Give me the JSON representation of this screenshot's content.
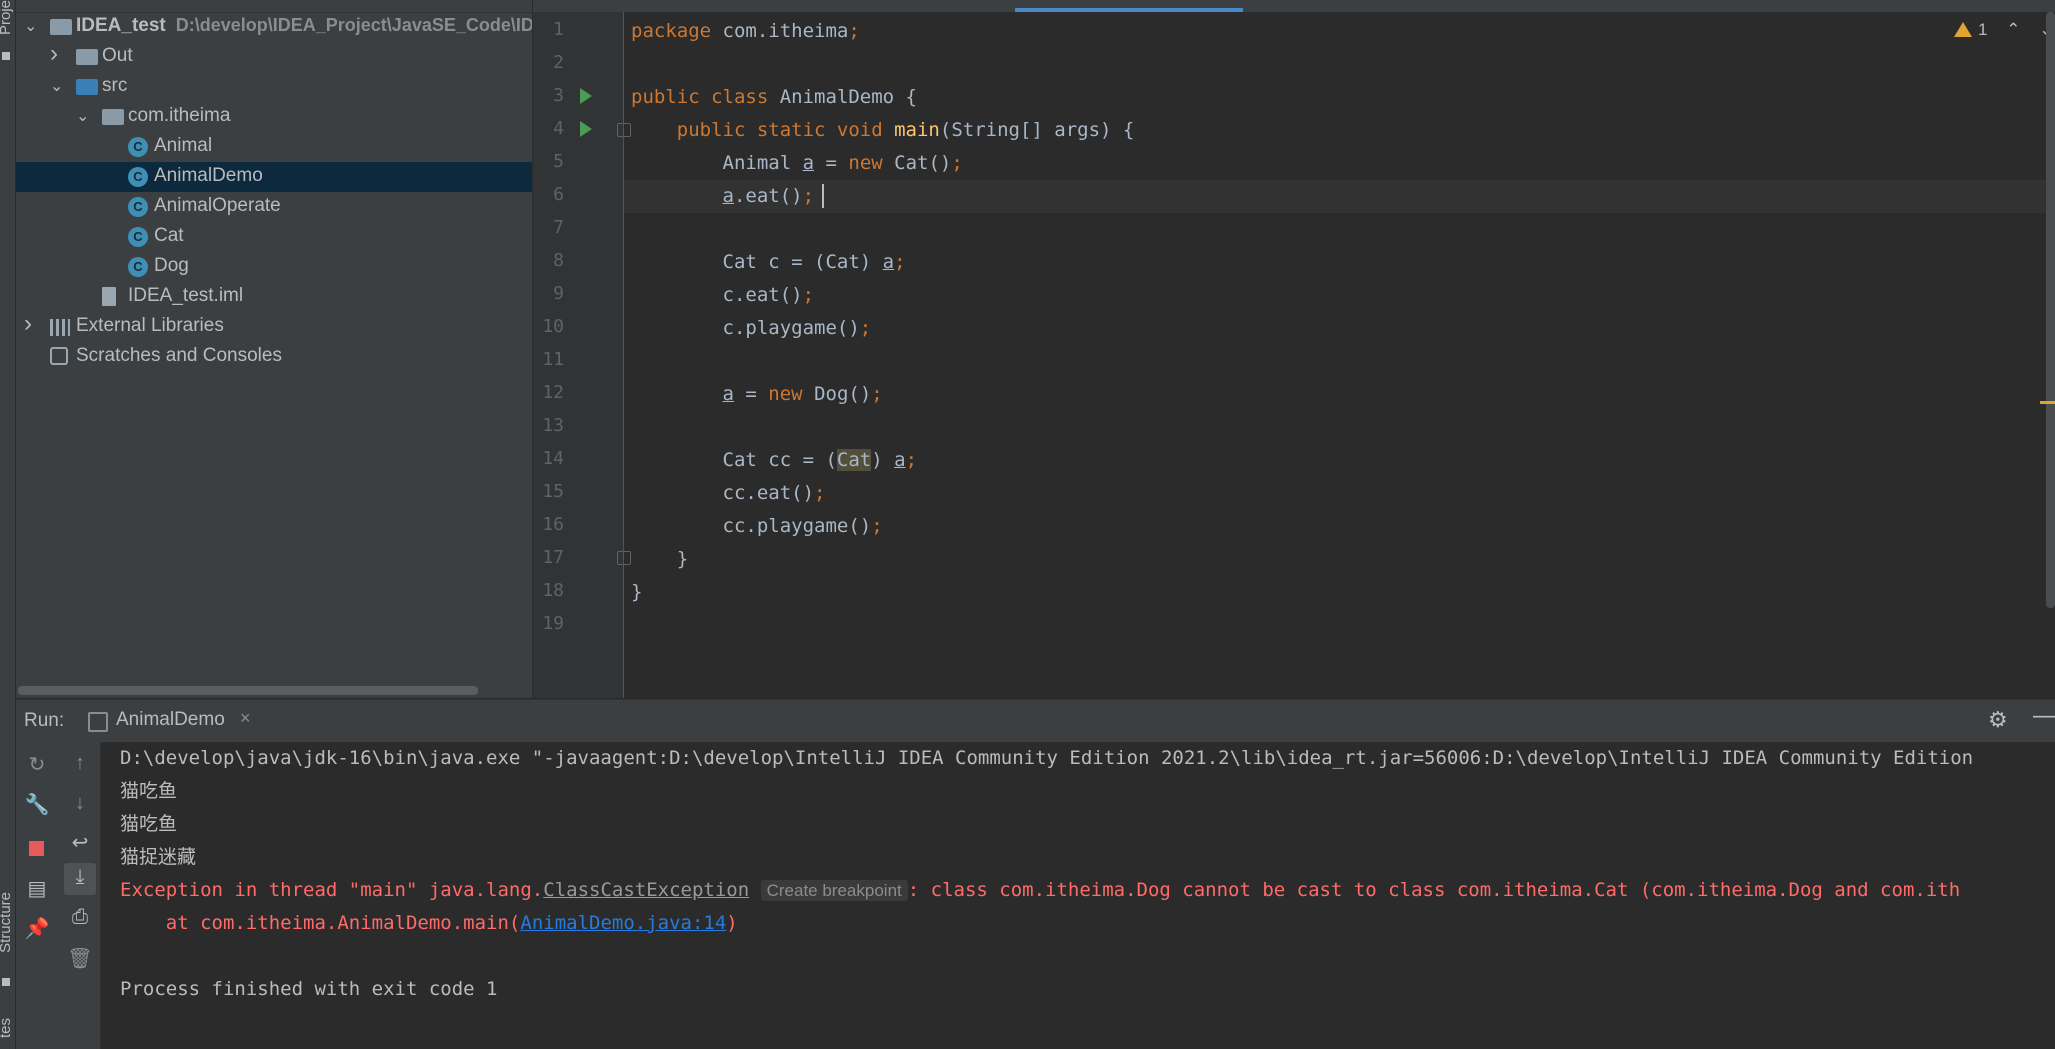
{
  "left_strip": {
    "top_label": "Proje",
    "structure_label": "Structure",
    "bottom_label": "tes"
  },
  "project_tree": [
    {
      "label": "IDEA_test",
      "hint": "D:\\develop\\IDEA_Project\\JavaSE_Code\\IDE",
      "icon": "module-folder-icon",
      "expanded": true,
      "depth": 0
    },
    {
      "label": "Out",
      "icon": "folder-icon",
      "expanded": false,
      "depth": 1
    },
    {
      "label": "src",
      "icon": "source-folder-icon",
      "expanded": true,
      "depth": 1
    },
    {
      "label": "com.itheima",
      "icon": "package-icon",
      "expanded": true,
      "depth": 2
    },
    {
      "label": "Animal",
      "icon": "class-icon",
      "depth": 3
    },
    {
      "label": "AnimalDemo",
      "icon": "class-run-icon",
      "depth": 3,
      "selected": true
    },
    {
      "label": "AnimalOperate",
      "icon": "class-icon",
      "depth": 3
    },
    {
      "label": "Cat",
      "icon": "class-icon",
      "depth": 3
    },
    {
      "label": "Dog",
      "icon": "class-icon",
      "depth": 3
    },
    {
      "label": "IDEA_test.iml",
      "icon": "iml-file-icon",
      "depth": 2
    },
    {
      "label": "External Libraries",
      "icon": "libraries-icon",
      "expanded": false,
      "depth": 0
    },
    {
      "label": "Scratches and Consoles",
      "icon": "scratches-icon",
      "depth": 0
    }
  ],
  "editor": {
    "warning_count": "1",
    "line_numbers": [
      "1",
      "2",
      "3",
      "4",
      "5",
      "6",
      "7",
      "8",
      "9",
      "10",
      "11",
      "12",
      "13",
      "14",
      "15",
      "16",
      "17",
      "18",
      "19"
    ],
    "lines": [
      [
        [
          "kw",
          "package "
        ],
        [
          "",
          "com.itheima"
        ],
        [
          "kw",
          ";"
        ]
      ],
      [],
      [
        [
          "kw",
          "public class "
        ],
        [
          "",
          "AnimalDemo {"
        ]
      ],
      [
        [
          "",
          "    "
        ],
        [
          "kw",
          "public static void "
        ],
        [
          "fn",
          "main"
        ],
        [
          "",
          "(String[] args) {"
        ]
      ],
      [
        [
          "",
          "        Animal "
        ],
        [
          "ul",
          "a"
        ],
        [
          "",
          " = "
        ],
        [
          "kw",
          "new "
        ],
        [
          "",
          "Cat()"
        ],
        [
          "kw",
          ";"
        ]
      ],
      [
        [
          "",
          "        "
        ],
        [
          "ul",
          "a"
        ],
        [
          "",
          ".eat()"
        ],
        [
          "kw",
          ";"
        ]
      ],
      [],
      [
        [
          "",
          "        Cat c = (Cat) "
        ],
        [
          "ul",
          "a"
        ],
        [
          "kw",
          ";"
        ]
      ],
      [
        [
          "",
          "        c.eat()"
        ],
        [
          "kw",
          ";"
        ]
      ],
      [
        [
          "",
          "        c.playgame()"
        ],
        [
          "kw",
          ";"
        ]
      ],
      [],
      [
        [
          "",
          "        "
        ],
        [
          "ul",
          "a"
        ],
        [
          "",
          " = "
        ],
        [
          "kw",
          "new "
        ],
        [
          "",
          "Dog()"
        ],
        [
          "kw",
          ";"
        ]
      ],
      [],
      [
        [
          "",
          "        Cat cc = ("
        ],
        [
          "hl",
          "Cat"
        ],
        [
          "",
          ") "
        ],
        [
          "ul",
          "a"
        ],
        [
          "kw",
          ";"
        ]
      ],
      [
        [
          "",
          "        cc.eat()"
        ],
        [
          "kw",
          ";"
        ]
      ],
      [
        [
          "",
          "        cc.playgame()"
        ],
        [
          "kw",
          ";"
        ]
      ],
      [
        [
          "",
          "    }"
        ]
      ],
      [
        [
          "",
          "}"
        ]
      ],
      []
    ]
  },
  "run_panel": {
    "label": "Run:",
    "tab_label": "AnimalDemo",
    "console": {
      "command": "D:\\develop\\java\\jdk-16\\bin\\java.exe \"-javaagent:D:\\develop\\IntelliJ IDEA Community Edition 2021.2\\lib\\idea_rt.jar=56006:D:\\develop\\IntelliJ IDEA Community Edition",
      "out1": "猫吃鱼",
      "out2": "猫吃鱼",
      "out3": "猫捉迷藏",
      "exc_prefix": "Exception in thread \"main\" java.lang.",
      "exc_class": "ClassCastException",
      "create_breakpoint": "Create breakpoint",
      "exc_suffix": ": class com.itheima.Dog cannot be cast to class com.itheima.Cat (com.itheima.Dog and com.ith",
      "at_prefix": "    at com.itheima.AnimalDemo.main(",
      "at_link": "AnimalDemo.java:14",
      "at_suffix": ")",
      "finished": "Process finished with exit code 1"
    }
  }
}
